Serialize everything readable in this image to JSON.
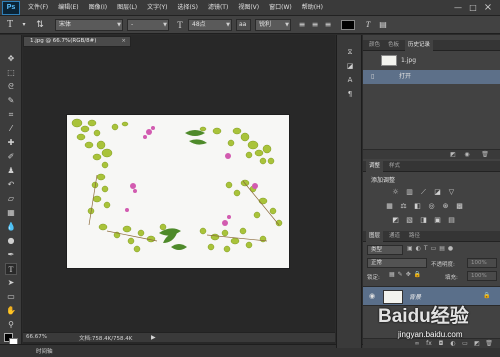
{
  "app": {
    "logo": "Ps"
  },
  "menu": [
    "文件(F)",
    "编辑(E)",
    "图像(I)",
    "图层(L)",
    "文字(Y)",
    "选择(S)",
    "滤镜(T)",
    "视图(V)",
    "窗口(W)",
    "帮助(H)"
  ],
  "window_controls": {
    "minimize": "—",
    "maximize": "□",
    "close": "×"
  },
  "options": {
    "font_family": "宋体",
    "font_style": "-",
    "font_size": "48点",
    "aa_label": "aa",
    "aa_mode": "锐利"
  },
  "document": {
    "tab_title": "1.jpg @ 66.7%(RGB/8#)",
    "zoom": "66.67%",
    "doc_size": "文档:758.4K/758.4K",
    "timeline_label": "时间轴"
  },
  "history_panel": {
    "tabs": [
      "颜色",
      "色板",
      "历史记录"
    ],
    "snapshot_name": "1.jpg",
    "steps": [
      "打开"
    ]
  },
  "adjustments_panel": {
    "tabs": [
      "调整",
      "样式"
    ],
    "title": "添加调整"
  },
  "layers_panel": {
    "tabs": [
      "图层",
      "通道",
      "路径"
    ],
    "kind_filter": "类型",
    "blend_mode": "正常",
    "opacity_label": "不透明度:",
    "opacity_value": "100%",
    "lock_label": "锁定:",
    "fill_label": "填充:",
    "fill_value": "100%",
    "layers": [
      {
        "name": "背景"
      }
    ]
  },
  "watermark": {
    "brand": "Baidu经验",
    "url": "jingyan.baidu.com"
  },
  "colors": {
    "accent_blue": "#5a6f8a",
    "leaf_green": "#a9c33a",
    "flower_pink": "#d25bb0"
  }
}
